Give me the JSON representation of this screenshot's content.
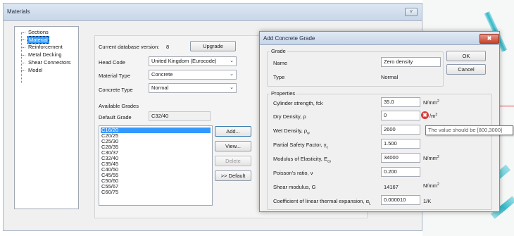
{
  "materials_dialog": {
    "title": "Materials",
    "collapse_symbol": "⋎"
  },
  "tree": {
    "items": [
      "Sections",
      "Material",
      "Reinforcement",
      "Metal Decking",
      "Shear Connectors",
      "Model"
    ],
    "selected": "Material"
  },
  "material_panel": {
    "db_version_label": "Current database version:",
    "db_version_value": "8",
    "upgrade_label": "Upgrade",
    "head_code_label": "Head Code",
    "head_code_value": "United Kingdom (Eurocode)",
    "material_type_label": "Material Type",
    "material_type_value": "Concrete",
    "concrete_type_label": "Concrete Type",
    "concrete_type_value": "Normal",
    "available_grades_label": "Available Grades",
    "default_grade_label": "Default Grade",
    "default_grade_value": "C32/40",
    "grades": [
      "C16/20",
      "C20/25",
      "C25/30",
      "C28/35",
      "C30/37",
      "C32/40",
      "C35/45",
      "C40/50",
      "C45/55",
      "C50/60",
      "C55/67",
      "C60/75"
    ],
    "selected_grade": "C16/20",
    "buttons": {
      "add": "Add...",
      "view": "View...",
      "delete": "Delete",
      "default": ">> Default"
    }
  },
  "add_grade_dialog": {
    "title": "Add Concrete Grade",
    "close_symbol": "✖",
    "ok_label": "OK",
    "cancel_label": "Cancel",
    "grade_group_label": "Grade",
    "name_label": "Name",
    "name_value": "Zero density",
    "type_label": "Type",
    "type_value": "Normal",
    "properties_group_label": "Properties",
    "properties": {
      "cylinder_strength": {
        "label": "Cylinder strength, fck",
        "value": "35.0",
        "unit": "N/mm",
        "unit_sup": "2"
      },
      "dry_density": {
        "label": "Dry Density, ρ",
        "value": "0",
        "unit": "/m",
        "unit_sup": "3"
      },
      "wet_density": {
        "label": "Wet Density, ρ",
        "label_sub": "w",
        "value": "2600"
      },
      "partial_safety_factor": {
        "label": "Partial Safety Factor, γ",
        "label_sub": "c",
        "value": "1.500"
      },
      "modulus_elasticity": {
        "label": "Modulus of Elasticity, E",
        "label_sub": "cs",
        "value": "34000",
        "unit": "N/mm",
        "unit_sup": "2"
      },
      "poissons_ratio": {
        "label": "Poisson's ratio, ν",
        "value": "0.200"
      },
      "shear_modulus": {
        "label": "Shear modulus, G",
        "value": "14167",
        "unit": "N/mm",
        "unit_sup": "2"
      },
      "thermal_expansion": {
        "label": "Coefficient of linear thermal expansion, α",
        "label_sub": "L",
        "value": "0.000010",
        "unit": "1/K"
      }
    },
    "error_symbol": "✖",
    "tooltip_text": "The value should be [800,3000]"
  },
  "colors": {
    "selection": "#3399ff",
    "error": "#d93a3a",
    "close_button": "#c4412b",
    "canvas_beam": "#33b7c7"
  }
}
